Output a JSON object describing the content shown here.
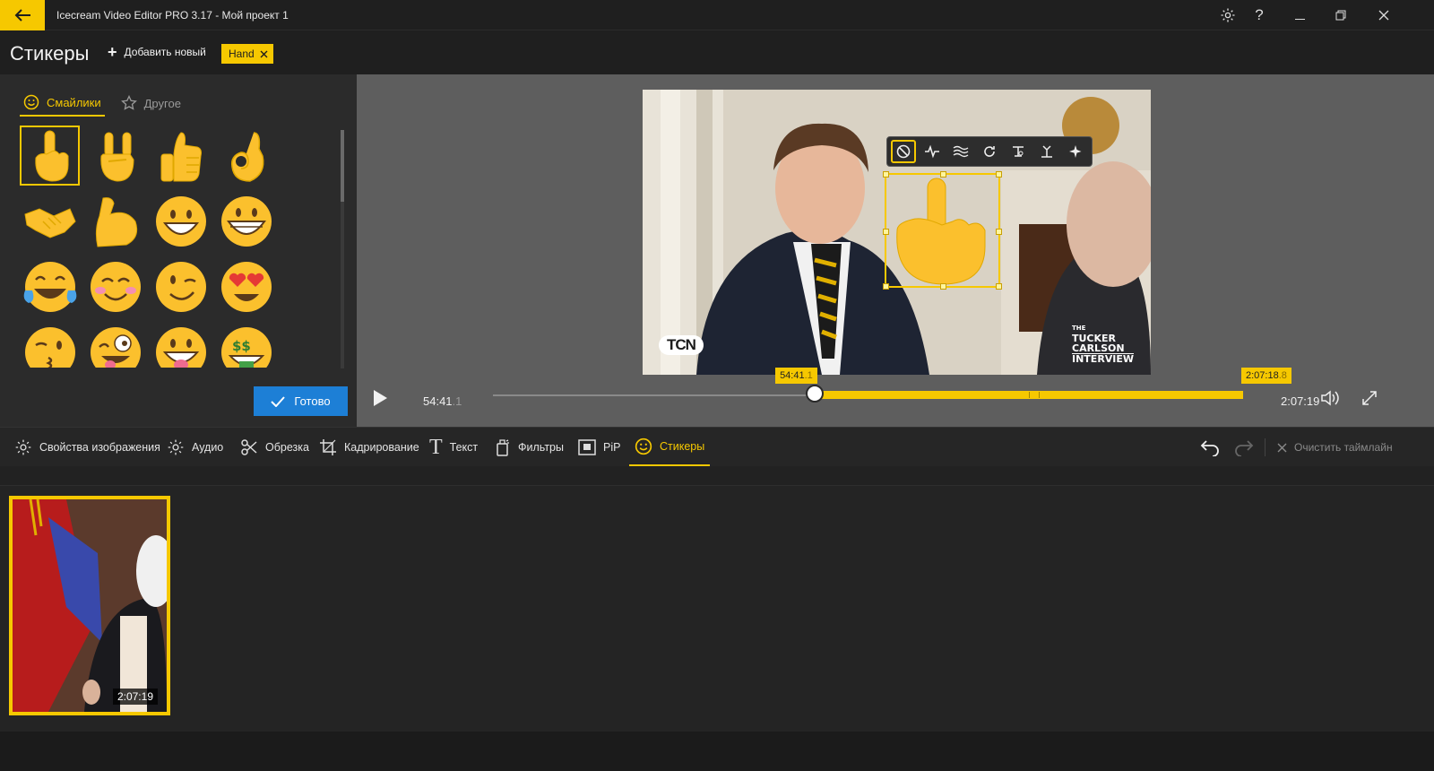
{
  "app": {
    "title": "Icecream Video Editor PRO 3.17   -   Мой проект 1"
  },
  "header": {
    "title": "Стикеры",
    "add_new_label": "Добавить новый",
    "tag_label": "Hand"
  },
  "sticker_panel": {
    "tabs": [
      {
        "label": "Смайлики",
        "icon": "smiley-icon",
        "active": true
      },
      {
        "label": "Другое",
        "icon": "star-icon",
        "active": false
      }
    ],
    "stickers": [
      "pointing-up-hand",
      "rock-on-hand",
      "thumbs-up",
      "ok-hand",
      "handshake",
      "flexed-biceps",
      "grinning-face",
      "beaming-face",
      "tears-of-joy",
      "smiling-blush",
      "winking-face",
      "heart-eyes",
      "kissing-wink",
      "zany-face",
      "tongue-out",
      "money-mouth"
    ],
    "done_label": "Готово"
  },
  "preview": {
    "watermark_left": "TCN",
    "watermark_right_1": "THE",
    "watermark_right_2": "TUCKER",
    "watermark_right_3": "CARLSON",
    "watermark_right_4": "INTERVIEW",
    "current_time": "54:41",
    "current_frac": ".1",
    "total_time": "2:07:19",
    "start_marker": "54:41",
    "start_marker_frac": ".1",
    "end_marker": "2:07:18",
    "end_marker_frac": ".8",
    "range_start_fraction": 0.429,
    "range_end_fraction": 1.0
  },
  "toolbar": {
    "items": [
      {
        "label": "Свойства изображения",
        "icon": "gear-icon"
      },
      {
        "label": "Аудио",
        "icon": "gear-icon"
      },
      {
        "label": "Обрезка",
        "icon": "scissors-icon"
      },
      {
        "label": "Кадрирование",
        "icon": "crop-icon"
      },
      {
        "label": "Текст",
        "icon": "text-icon"
      },
      {
        "label": "Фильтры",
        "icon": "filter-icon"
      },
      {
        "label": "PiP",
        "icon": "pip-icon"
      },
      {
        "label": "Стикеры",
        "icon": "smiley-icon"
      }
    ],
    "clear_label": "Очистить таймлайн"
  },
  "timeline": {
    "clip_duration": "2:07:19"
  },
  "colors": {
    "accent": "#f6c800",
    "primary_button": "#1d7fd6"
  }
}
